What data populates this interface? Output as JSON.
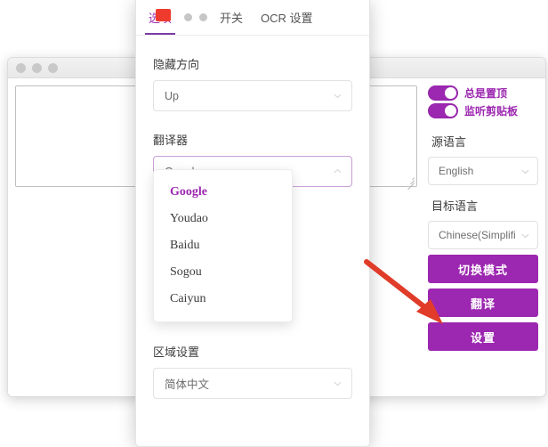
{
  "background_window": {
    "traffic_lights": [
      "close-dot",
      "minimize-dot",
      "maximize-dot"
    ],
    "source_textarea": {
      "value": "",
      "placeholder": ""
    },
    "controls": {
      "toggles": [
        {
          "label": "总是置顶",
          "state": "on"
        },
        {
          "label": "监听剪贴板",
          "state": "on"
        }
      ],
      "source_language": {
        "label": "源语言",
        "value": "English"
      },
      "target_language": {
        "label": "目标语言",
        "value": "Chinese(Simplifi"
      },
      "buttons": [
        {
          "label": "切换模式"
        },
        {
          "label": "翻译"
        },
        {
          "label": "设置"
        }
      ]
    }
  },
  "settings_modal": {
    "tabs": [
      {
        "label": "选项",
        "active": true
      },
      {
        "label": "开关",
        "active": false
      },
      {
        "label": "OCR 设置",
        "active": false
      }
    ],
    "fields": {
      "hide_direction": {
        "label": "隐藏方向",
        "value": "Up"
      },
      "translator": {
        "label": "翻译器",
        "value": "Google"
      },
      "locale": {
        "label": "区域设置",
        "value": "简体中文"
      }
    },
    "translator_dropdown": {
      "open": true,
      "selected": "Google",
      "options": [
        "Google",
        "Youdao",
        "Baidu",
        "Sogou",
        "Caiyun"
      ]
    }
  },
  "annotation": {
    "arrow_color": "#e03c29",
    "points_at": "设置"
  },
  "colors": {
    "accent_purple": "#9C27B0",
    "tab_underline": "#7B3BA8",
    "cursor_red": "#ef3b2d",
    "arrow_red": "#e03c29"
  }
}
